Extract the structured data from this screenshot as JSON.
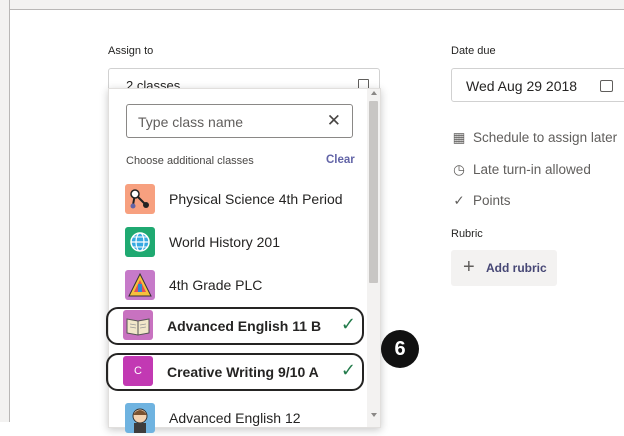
{
  "assign": {
    "label": "Assign to",
    "value": "2 classes"
  },
  "dropdown": {
    "search_placeholder": "Type class name",
    "choose_label": "Choose additional classes",
    "clear_label": "Clear",
    "classes": [
      {
        "name": "Physical Science 4th Period",
        "icon": "molecule-icon",
        "selected": false
      },
      {
        "name": "World History 201",
        "icon": "globe-icon",
        "selected": false
      },
      {
        "name": "4th Grade PLC",
        "icon": "pencil-triangle-icon",
        "selected": false
      },
      {
        "name": "Advanced English 11 B",
        "icon": "book-icon",
        "selected": true
      },
      {
        "name": "Creative Writing 9/10 A",
        "icon": "letter-c-icon",
        "icon_letter": "C",
        "selected": true
      },
      {
        "name": "Advanced English 12",
        "icon": "shakespeare-icon",
        "selected": false
      }
    ]
  },
  "step_badge": "6",
  "date": {
    "label": "Date due",
    "value": "Wed Aug 29 2018"
  },
  "options": {
    "schedule": "Schedule to assign later",
    "late": "Late turn-in allowed",
    "points": "Points"
  },
  "rubric": {
    "label": "Rubric",
    "add_label": "Add rubric"
  },
  "colors": {
    "accent": "#6264a7",
    "check": "#237b4b",
    "creative_writing": "#c239b3"
  }
}
